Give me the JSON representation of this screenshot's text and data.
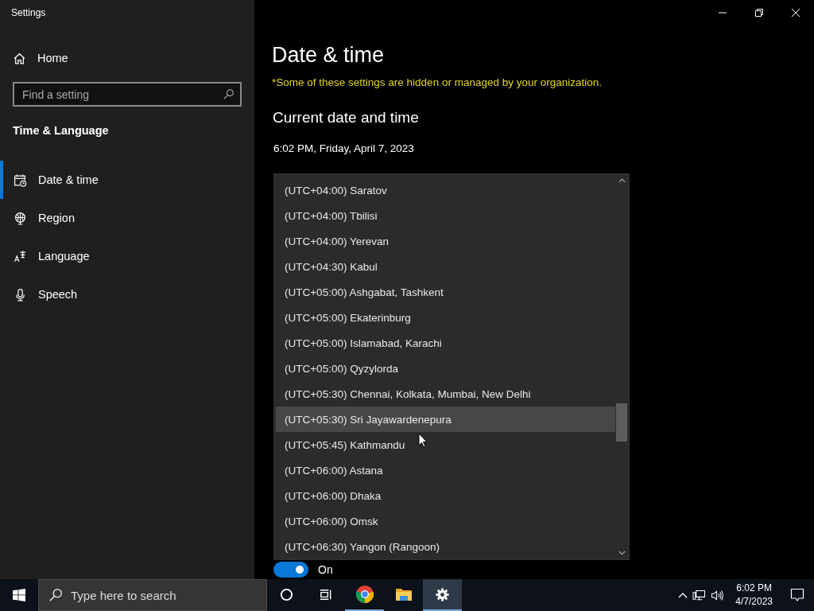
{
  "window": {
    "title": "Settings"
  },
  "sidebar": {
    "home": "Home",
    "search": {
      "placeholder": "Find a setting"
    },
    "section": "Time & Language",
    "items": [
      {
        "kind": "date",
        "label": "Date & time",
        "selected": true
      },
      {
        "kind": "region",
        "label": "Region",
        "selected": false
      },
      {
        "kind": "language",
        "label": "Language",
        "selected": false
      },
      {
        "kind": "speech",
        "label": "Speech",
        "selected": false
      }
    ]
  },
  "main": {
    "title": "Date & time",
    "notice": "*Some of these settings are hidden or managed by your organization.",
    "heading": "Current date and time",
    "current": "6:02 PM, Friday, April 7, 2023",
    "toggle": {
      "on": true,
      "label": "On"
    },
    "timezone_list": [
      {
        "label": "(UTC+04:00) Saratov",
        "highlighted": false
      },
      {
        "label": "(UTC+04:00) Tbilisi",
        "highlighted": false
      },
      {
        "label": "(UTC+04:00) Yerevan",
        "highlighted": false
      },
      {
        "label": "(UTC+04:30) Kabul",
        "highlighted": false
      },
      {
        "label": "(UTC+05:00) Ashgabat, Tashkent",
        "highlighted": false
      },
      {
        "label": "(UTC+05:00) Ekaterinburg",
        "highlighted": false
      },
      {
        "label": "(UTC+05:00) Islamabad, Karachi",
        "highlighted": false
      },
      {
        "label": "(UTC+05:00) Qyzylorda",
        "highlighted": false
      },
      {
        "label": "(UTC+05:30) Chennai, Kolkata, Mumbai, New Delhi",
        "highlighted": false
      },
      {
        "label": "(UTC+05:30) Sri Jayawardenepura",
        "highlighted": true
      },
      {
        "label": "(UTC+05:45) Kathmandu",
        "highlighted": false
      },
      {
        "label": "(UTC+06:00) Astana",
        "highlighted": false
      },
      {
        "label": "(UTC+06:00) Dhaka",
        "highlighted": false
      },
      {
        "label": "(UTC+06:00) Omsk",
        "highlighted": false
      },
      {
        "label": "(UTC+06:30) Yangon (Rangoon)",
        "highlighted": false
      }
    ]
  },
  "taskbar": {
    "search": {
      "placeholder": "Type here to search"
    },
    "apps": [
      {
        "kind": "cortana",
        "running": false,
        "active": false
      },
      {
        "kind": "taskview",
        "running": false,
        "active": false
      },
      {
        "kind": "chrome",
        "running": true,
        "active": false
      },
      {
        "kind": "explorer",
        "running": false,
        "active": false
      },
      {
        "kind": "settings",
        "running": true,
        "active": true
      }
    ],
    "time": "6:02 PM",
    "date": "4/7/2023"
  }
}
